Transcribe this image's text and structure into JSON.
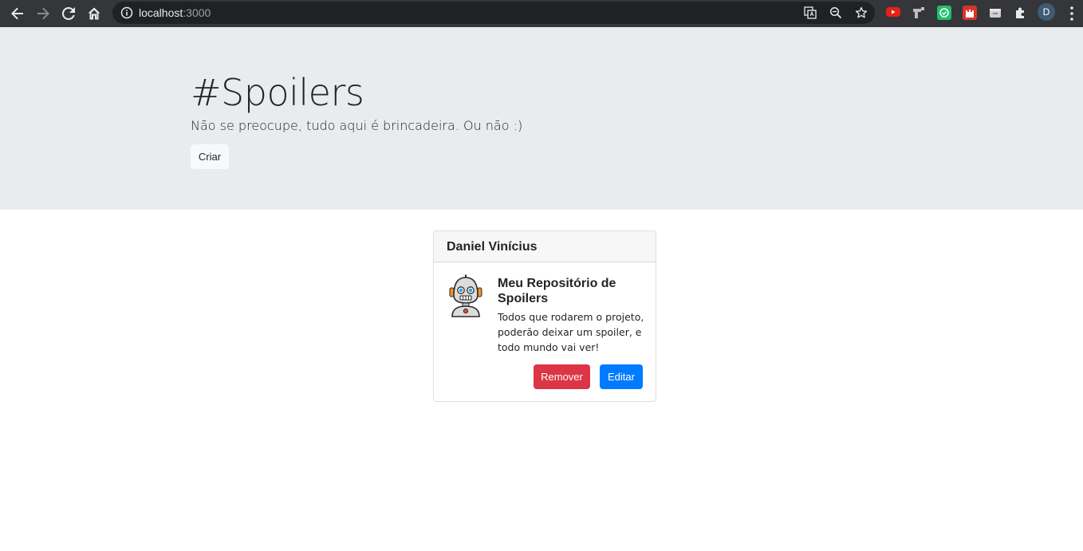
{
  "browser": {
    "url_host": "localhost",
    "url_port": ":3000",
    "profile_initial": "D",
    "icons": [
      "back-icon",
      "forward-icon",
      "reload-icon",
      "home-icon",
      "info-icon",
      "translate-icon",
      "zoom-icon",
      "star-icon",
      "puzzle-icon",
      "menu-icon"
    ]
  },
  "jumbotron": {
    "title": "#Spoilers",
    "lead": "Não se preocupe, tudo aqui é brincadeira. Ou não :)",
    "create_label": "Criar"
  },
  "card": {
    "author": "Daniel Vinícius",
    "title": "Meu Repositório de Spoilers",
    "text": "Todos que rodarem o projeto, poderão deixar um spoiler, e todo mundo vai ver!",
    "remove_label": "Remover",
    "edit_label": "Editar"
  },
  "colors": {
    "danger": "#dc3545",
    "primary": "#007bff",
    "jumbotron_bg": "#e9ecef",
    "browser_bar": "#35363a"
  }
}
